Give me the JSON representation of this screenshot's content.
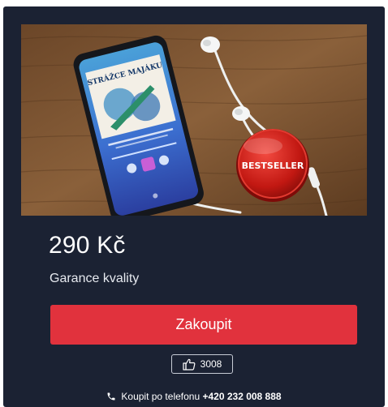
{
  "product": {
    "price": "290 Kč",
    "quality_label": "Garance kvality",
    "buy_label": "Zakoupit",
    "likes": "3008",
    "badge": "BESTSELLER",
    "book_title": "STRÁŽCE MAJÁKU"
  },
  "phone_order": {
    "label": "Koupit po telefonu",
    "number": "+420 232 008 888"
  },
  "icons": {
    "like": "thumbs-up-icon",
    "phone": "phone-icon"
  },
  "colors": {
    "card_bg": "#1b2233",
    "buy_button": "#e1323d",
    "badge": "#d0201e"
  }
}
